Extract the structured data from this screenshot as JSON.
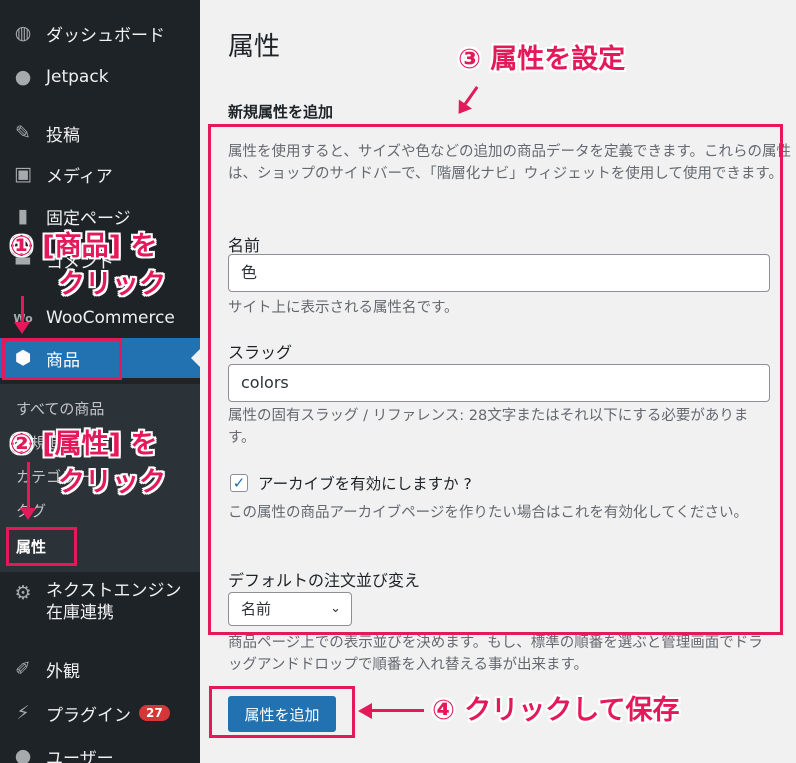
{
  "sidebar": {
    "items": [
      {
        "label": "ダッシュボード",
        "icon": "dashboard-icon"
      },
      {
        "label": "Jetpack",
        "icon": "jetpack-icon"
      },
      {
        "label": "投稿",
        "icon": "pushpin-icon"
      },
      {
        "label": "メディア",
        "icon": "media-icon"
      },
      {
        "label": "固定ページ",
        "icon": "pages-icon"
      },
      {
        "label": "コメント",
        "icon": "comments-icon"
      },
      {
        "label": "WooCommerce",
        "icon": "woocommerce-icon"
      },
      {
        "label": "商品",
        "icon": "box-icon"
      },
      {
        "label": "ネクストエンジン在庫連携",
        "icon": "gear-icon"
      },
      {
        "label": "外観",
        "icon": "brush-icon"
      },
      {
        "label": "プラグイン",
        "icon": "plugin-icon",
        "badge": "27"
      },
      {
        "label": "ユーザー",
        "icon": "user-icon"
      }
    ],
    "submenu": [
      {
        "label": "すべての商品"
      },
      {
        "label": "新規追加"
      },
      {
        "label": "カテゴリー"
      },
      {
        "label": "タグ"
      },
      {
        "label": "属性"
      }
    ]
  },
  "main": {
    "page_title": "属性",
    "section_title": "新規属性を追加",
    "intro": "属性を使用すると、サイズや色などの追加の商品データを定義できます。これらの属性は、ショップのサイドバーで、「階層化ナビ」ウィジェットを使用して使用できます。",
    "name_label": "名前",
    "name_value": "色",
    "name_help": "サイト上に表示される属性名です。",
    "slug_label": "スラッグ",
    "slug_value": "colors",
    "slug_help": "属性の固有スラッグ / リファレンス: 28文字またはそれ以下にする必要があります。",
    "archive_label": "アーカイブを有効にしますか ?",
    "archive_checked": true,
    "archive_help": "この属性の商品アーカイブページを作りたい場合はこれを有効化してください。",
    "order_label": "デフォルトの注文並び変え",
    "order_value": "名前",
    "order_help": "商品ページ上での表示並びを決めます。もし、標準の順番を選ぶと管理画面でドラッグアンドドロップで順番を入れ替える事が出来ます。",
    "submit_label": "属性を追加"
  },
  "annotations": {
    "step1_line1": "① [商品] を",
    "step1_line2": "クリック",
    "step2_line1": "② [属性] を",
    "step2_line2": "クリック",
    "step3": "③ 属性を設定",
    "step4": "④ クリックして保存",
    "color": "#e4195a"
  },
  "colors": {
    "sidebar_bg": "#1d2327",
    "submenu_bg": "#2c3338",
    "accent": "#2271b1",
    "badge": "#d63638"
  }
}
